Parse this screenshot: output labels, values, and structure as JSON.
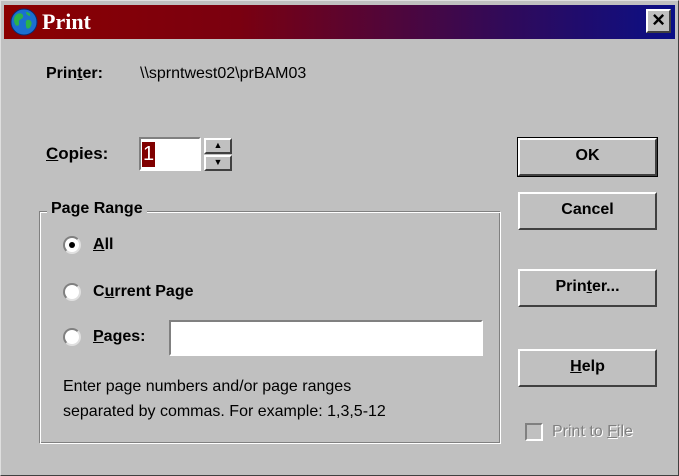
{
  "window": {
    "title": "Print",
    "close_label": "×"
  },
  "printer": {
    "label": "Printer:",
    "value": "\\\\sprntwest02\\prBAM03"
  },
  "copies": {
    "label": "Copies:",
    "value": "1"
  },
  "page_range": {
    "title": "Page Range",
    "options": [
      {
        "label": "All",
        "selected": true
      },
      {
        "label": "Current Page",
        "selected": false
      },
      {
        "label": "Pages:",
        "selected": false
      }
    ],
    "pages_value": "",
    "hint_line1": "Enter page numbers and/or page ranges",
    "hint_line2": "separated by commas.  For example: 1,3,5-12"
  },
  "buttons": {
    "ok": "OK",
    "cancel": "Cancel",
    "printer": "Printer...",
    "help": "Help"
  },
  "print_to_file": {
    "label": "Print to File",
    "checked": false,
    "enabled": false
  },
  "colors": {
    "title_start": "#8b0000",
    "title_end": "#0a0f86",
    "face": "#c0c0c0"
  }
}
